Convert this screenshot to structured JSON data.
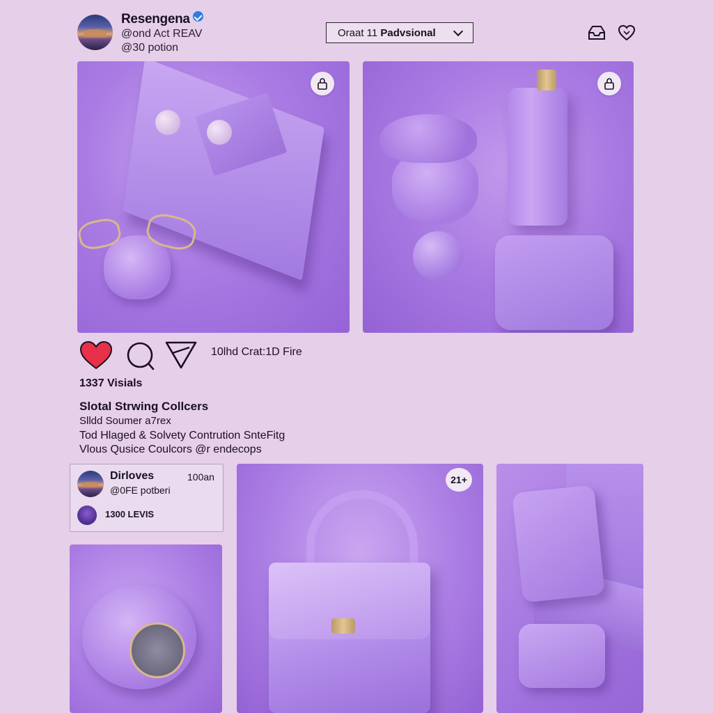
{
  "header": {
    "username": "Resengena",
    "handle_line": "@ond Act REAV",
    "sub_line": "@30 potion",
    "dropdown": {
      "prefix": "Oraat 11 ",
      "bold": "Padvsional"
    }
  },
  "post": {
    "share_text": "10lhd Crat:1D Fire",
    "stats": "1337 Visials",
    "caption_title": "Slotal Strwing Collcers",
    "caption_lines": [
      "Slldd Soumer a7rex",
      "Tod Hlaged & Solvety Contrution SnteFitg",
      "Vlous Qusice Coulcors @r endecops"
    ]
  },
  "comment_card": {
    "name": "Dirloves",
    "time": "100an",
    "handle": "@0FE potberi",
    "levels": "1300 LEVIS"
  },
  "gallery": {
    "count_badge": "21+"
  },
  "icons": {
    "like": "heart-icon",
    "comment": "comment-icon",
    "share": "send-icon",
    "lock": "lock-icon",
    "inbox": "inbox-icon",
    "favorites": "heart-outline-icon"
  },
  "colors": {
    "background": "#e6cfe9",
    "accent_purple": "#a97be3",
    "like_red": "#e8304a",
    "verified_blue": "#2f7de1"
  }
}
